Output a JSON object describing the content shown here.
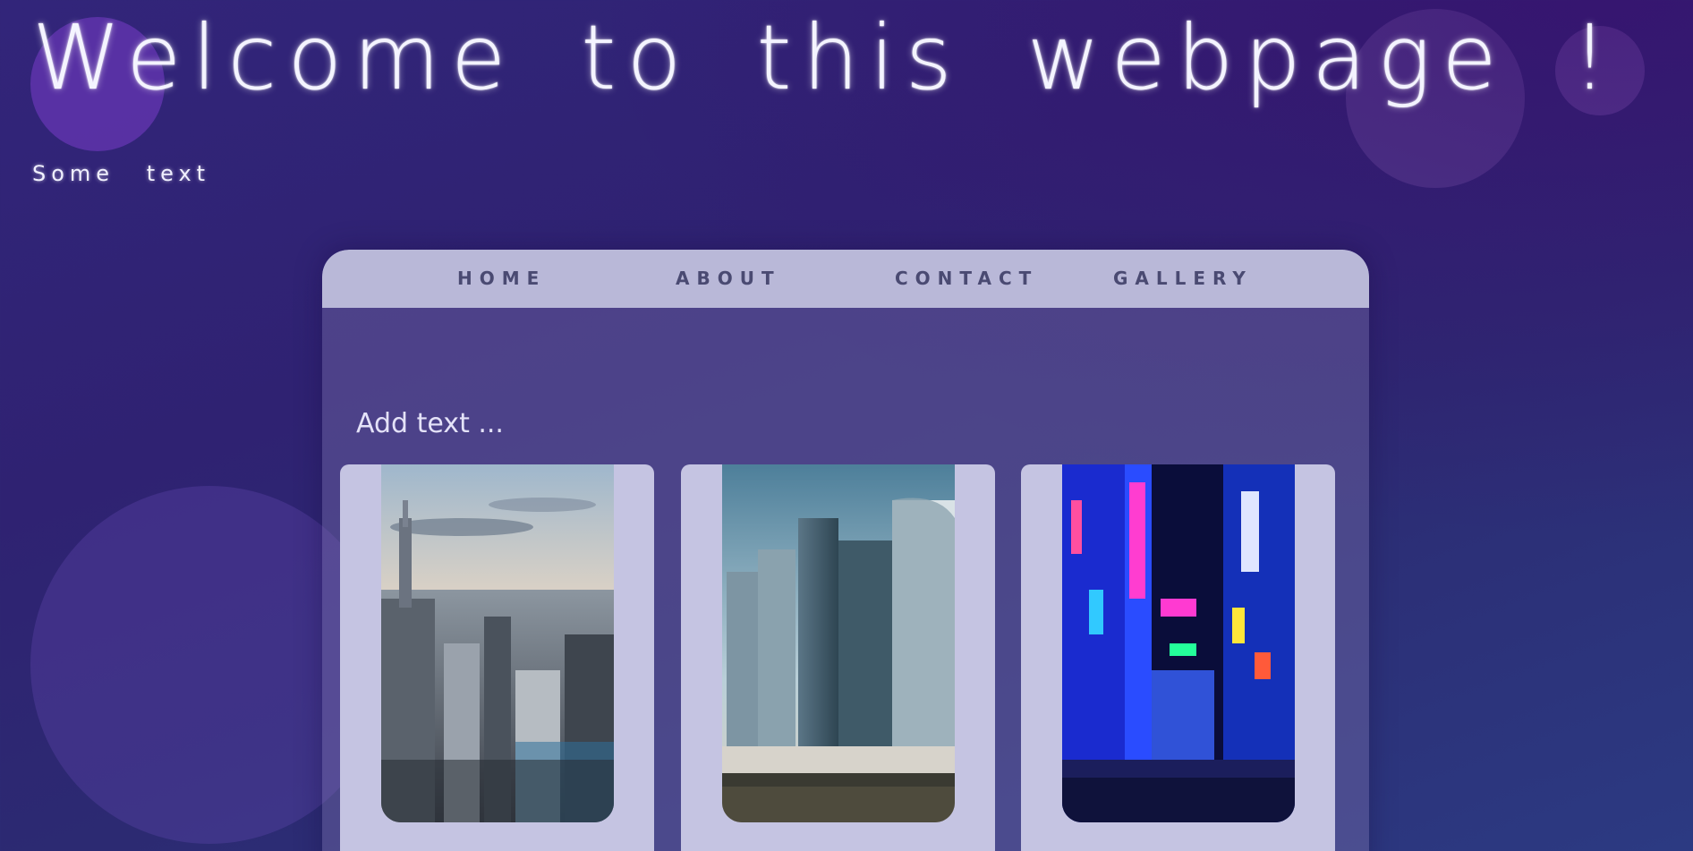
{
  "hero": {
    "title": "Welcome to this webpage !",
    "subtitle": "Some text"
  },
  "nav": {
    "items": [
      {
        "label": "HOME"
      },
      {
        "label": "ABOUT"
      },
      {
        "label": "CONTACT"
      },
      {
        "label": "GALLERY"
      }
    ]
  },
  "main": {
    "add_text": "Add text ...",
    "gallery": [
      {
        "icon": "new-york-skyline-photo"
      },
      {
        "icon": "glass-skyscrapers-photo"
      },
      {
        "icon": "neon-city-street-photo"
      }
    ]
  },
  "colors": {
    "background": "#2f2272",
    "nav_background": "#b9b8d8",
    "nav_text": "#4a4a72",
    "card_background": "#c5c4e2"
  }
}
